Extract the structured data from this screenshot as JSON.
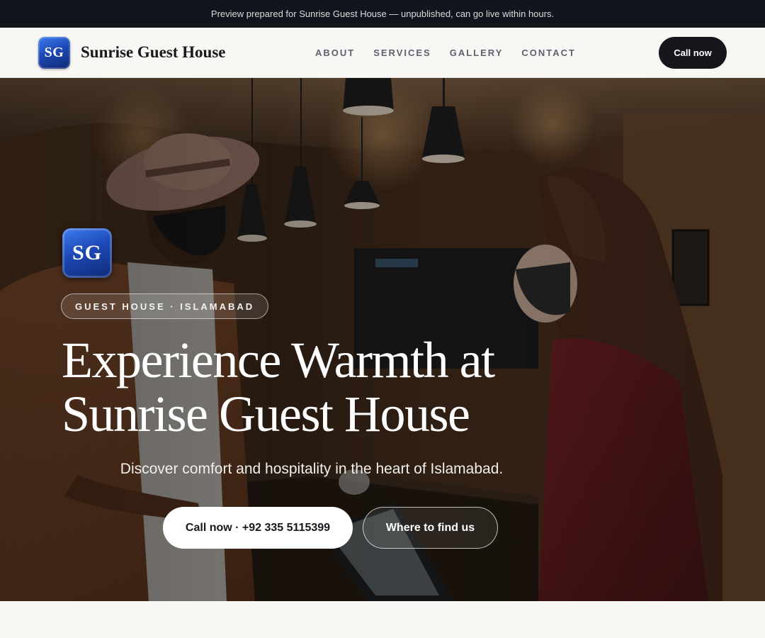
{
  "preview_banner": {
    "text": "Preview prepared for Sunrise Guest House — unpublished, can go live within hours."
  },
  "header": {
    "logo_text": "SG",
    "brand_name": "Sunrise Guest House",
    "nav": [
      {
        "label": "ABOUT"
      },
      {
        "label": "SERVICES"
      },
      {
        "label": "GALLERY"
      },
      {
        "label": "CONTACT"
      }
    ],
    "call_button": "Call now"
  },
  "hero": {
    "logo_text": "SG",
    "eyebrow": "GUEST HOUSE · ISLAMABAD",
    "title_line1": "Experience Warmth at",
    "title_line2": "Sunrise Guest House",
    "subtitle": "Discover comfort and hospitality in the heart of Islamabad.",
    "primary_button": "Call now · +92 335 5115399",
    "secondary_button": "Where to find us",
    "background_image": "photo-hotel-reception-masked-guest-and-receptionist"
  },
  "colors": {
    "banner_bg": "#12151b",
    "header_bg": "#f8f7f4",
    "dark_button": "#15171c",
    "logo_blue": "#1d49b6",
    "nav_text": "#5d6270"
  }
}
